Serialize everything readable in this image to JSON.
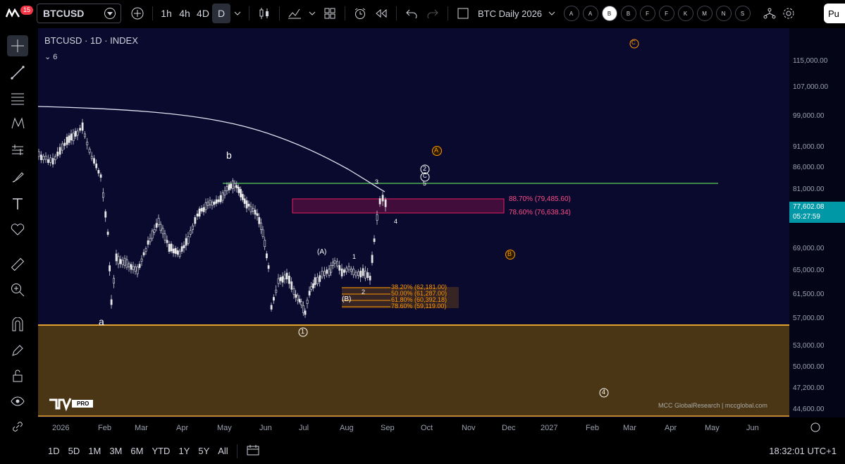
{
  "toolbar": {
    "notifications": "15",
    "symbol": "BTCUSD",
    "timeframes": [
      "1h",
      "4h",
      "4D",
      "D"
    ],
    "active_timeframe": "D",
    "layout_name": "BTC Daily 2026",
    "layout_letters": [
      "A",
      "A",
      "B",
      "B",
      "F",
      "F",
      "K",
      "M",
      "N",
      "S"
    ],
    "active_letter_index": 2,
    "publish": "Pu"
  },
  "legend": {
    "title": "BTCUSD · 1D · INDEX",
    "indicator_count": "6"
  },
  "price_axis": {
    "labels": [
      "115,000.00",
      "107,000.00",
      "99,000.00",
      "91,000.00",
      "86,000.00",
      "81,000.00",
      "69,000.00",
      "65,000.00",
      "61,500.00",
      "57,000.00",
      "53,000.00",
      "50,000.00",
      "47,200.00",
      "44,600.00"
    ],
    "current_price": "77,602.08",
    "countdown": "05:27:59"
  },
  "time_axis": {
    "labels": [
      "2026",
      "Feb",
      "Mar",
      "Apr",
      "May",
      "Jun",
      "Jul",
      "Aug",
      "Sep",
      "Oct",
      "Nov",
      "Dec",
      "2027",
      "Feb",
      "Mar",
      "Apr",
      "May",
      "Jun"
    ]
  },
  "annotations": {
    "wave_b": "b",
    "wave_a": "a",
    "wave_A_paren": "(A)",
    "wave_B_paren": "(B)",
    "wave_1": "1",
    "wave_2": "2",
    "wave_3": "3",
    "wave_4": "4",
    "wave_5": "5",
    "circ_A": "A",
    "circ_B": "B",
    "circ_C_top": "C",
    "circ_2": "2",
    "circ_C_white": "C",
    "circ_4": "4",
    "circ_1": "1",
    "fib_upper_1": "88.70% (79,485.60)",
    "fib_upper_2": "78.60% (76,638.34)",
    "fib_lower_1": "38.20% (62,181.00)",
    "fib_lower_2": "50.00% (61,287.00)",
    "fib_lower_3": "61.80% (60,392.18)",
    "fib_lower_4": "78.60% (59,119.00)",
    "watermark": "MCC GlobalResearch | mccglobal.com",
    "tv_logo": "PRO"
  },
  "bottom": {
    "ranges": [
      "1D",
      "5D",
      "1M",
      "3M",
      "6M",
      "YTD",
      "1Y",
      "5Y",
      "All"
    ],
    "clock": "18:32:01 UTC+1"
  },
  "colors": {
    "chart_bg": "#0a0a2e",
    "support_zone": "#4a3614",
    "support_line": "#e0a030",
    "resistance_line": "#4caf50",
    "fib_zone": "#c2185b",
    "fib_text": "#ff4d88",
    "orange": "#ff9800",
    "candle": "#e8e8e8"
  }
}
